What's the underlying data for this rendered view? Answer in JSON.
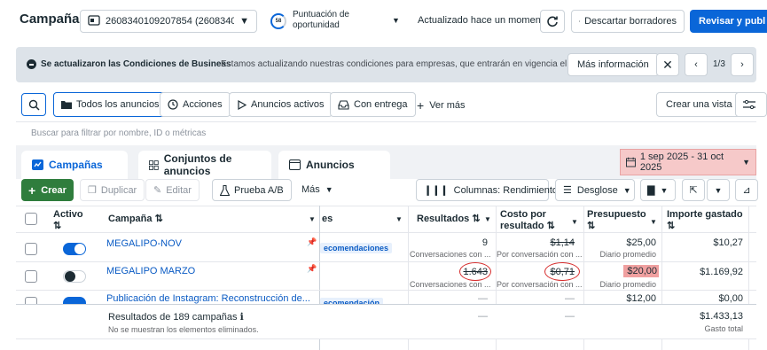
{
  "topbar": {
    "title": "Campañas",
    "account": "2608340109207854 (2608340...",
    "score_label": "Puntuación de oportunidad",
    "score_value": "58",
    "updated": "Actualizado hace un momento",
    "discard": "Descartar borradores",
    "review": "Revisar y publ"
  },
  "banner": {
    "title": "Se actualizaron las Condiciones de Business",
    "text": "Estamos actualizando nuestras condiciones para empresas, que entrarán en vigencia el...",
    "more": "Más información",
    "page": "1/3"
  },
  "filters": {
    "all_ads": "Todos los anuncios",
    "actions": "Acciones",
    "active_ads": "Anuncios activos",
    "delivery": "Con entrega",
    "more": "Ver más",
    "create_view": "Crear una vista",
    "search_placeholder": "Buscar para filtrar por nombre, ID o métricas"
  },
  "tabs": {
    "campaigns": "Campañas",
    "adsets": "Conjuntos de anuncios",
    "ads": "Anuncios",
    "date_range": "1 sep 2025 - 31 oct 2025"
  },
  "toolbar": {
    "create": "Crear",
    "duplicate": "Duplicar",
    "edit": "Editar",
    "abtest": "Prueba A/B",
    "more": "Más",
    "columns": "Columnas: Rendimiento",
    "breakdown": "Desglose"
  },
  "table": {
    "headers": {
      "active": "Activo",
      "campaign": "Campaña",
      "delivery": "es",
      "results": "Resultados",
      "cost1": "Costo por",
      "cost2": "resultado",
      "budget": "Presupuesto",
      "spent": "Importe gastado"
    },
    "rows": [
      {
        "name": "MEGALIPO-NOV",
        "delivery": "ecomendaciones",
        "results": "9",
        "results_sub": "Conversaciones con ...",
        "cost": "$1,14",
        "cost_sub": "Por conversación con ...",
        "budget": "$25,00",
        "budget_sub": "Diario promedio",
        "spent": "$10,27"
      },
      {
        "name": "MEGALIPO MARZO",
        "delivery": "",
        "results": "1.643",
        "results_sub": "Conversaciones con ...",
        "cost": "$0,71",
        "cost_sub": "Por conversación con ...",
        "budget": "$20,00",
        "budget_sub": "Diario promedio",
        "spent": "$1.169,92"
      },
      {
        "name": "Publicación de Instagram: Reconstrucción de...",
        "delivery": "ecomendación",
        "results": "—",
        "cost": "—",
        "budget": "$12,00",
        "spent": "$0,00"
      }
    ],
    "footer": {
      "title": "Resultados de 189 campañas",
      "note": "No se muestran los elementos eliminados.",
      "results": "—",
      "cost": "—",
      "spent": "$1.433,13",
      "spent_sub": "Gasto total"
    }
  },
  "colors": {
    "accent": "#0a66d8",
    "create_green": "#2f7d3d",
    "date_bg": "#f6c9c9",
    "highlight_red": "#f0a0a0"
  }
}
